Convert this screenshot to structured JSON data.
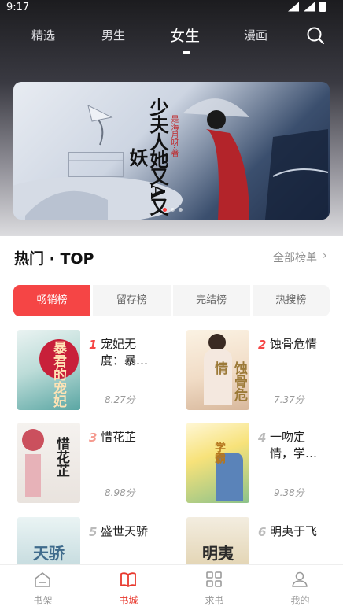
{
  "status_bar": {
    "time": "9:17"
  },
  "top_tabs": [
    {
      "label": "精选"
    },
    {
      "label": "男生"
    },
    {
      "label": "女生",
      "active": true
    },
    {
      "label": "漫画"
    }
  ],
  "banner": {
    "title": "少夫人她又A又妖",
    "author": "是海月呀·著",
    "slide_count": 3,
    "active_slide": 1
  },
  "section": {
    "title": "热门 · TOP",
    "more_label": "全部榜单"
  },
  "rank_tabs": [
    {
      "label": "畅销榜",
      "active": true
    },
    {
      "label": "留存榜"
    },
    {
      "label": "完结榜"
    },
    {
      "label": "热搜榜"
    }
  ],
  "books": [
    {
      "rank": "1",
      "title": "宠妃无度：暴…",
      "score": "8.27分",
      "cover_text": "暴君的宠妃",
      "rank_color": "#f54545"
    },
    {
      "rank": "2",
      "title": "蚀骨危情",
      "score": "7.37分",
      "cover_text": "蚀骨危情",
      "rank_color": "#f54545"
    },
    {
      "rank": "3",
      "title": "惜花芷",
      "score": "8.98分",
      "cover_text": "惜花芷",
      "rank_color": "#f59a8f"
    },
    {
      "rank": "4",
      "title": "一吻定情，学…",
      "score": "9.38分",
      "cover_text": "学霸",
      "rank_color": "#bbbbbb"
    },
    {
      "rank": "5",
      "title": "盛世天骄",
      "score": "",
      "cover_text": "天骄",
      "rank_color": "#bbbbbb"
    },
    {
      "rank": "6",
      "title": "明夷于飞",
      "score": "",
      "cover_text": "明夷",
      "rank_color": "#bbbbbb"
    }
  ],
  "bottom_nav": [
    {
      "label": "书架",
      "icon": "house-icon"
    },
    {
      "label": "书城",
      "icon": "book-icon",
      "active": true
    },
    {
      "label": "求书",
      "icon": "grid-icon"
    },
    {
      "label": "我的",
      "icon": "person-icon"
    }
  ],
  "colors": {
    "accent": "#f54545",
    "nav_active": "#e8392e"
  }
}
